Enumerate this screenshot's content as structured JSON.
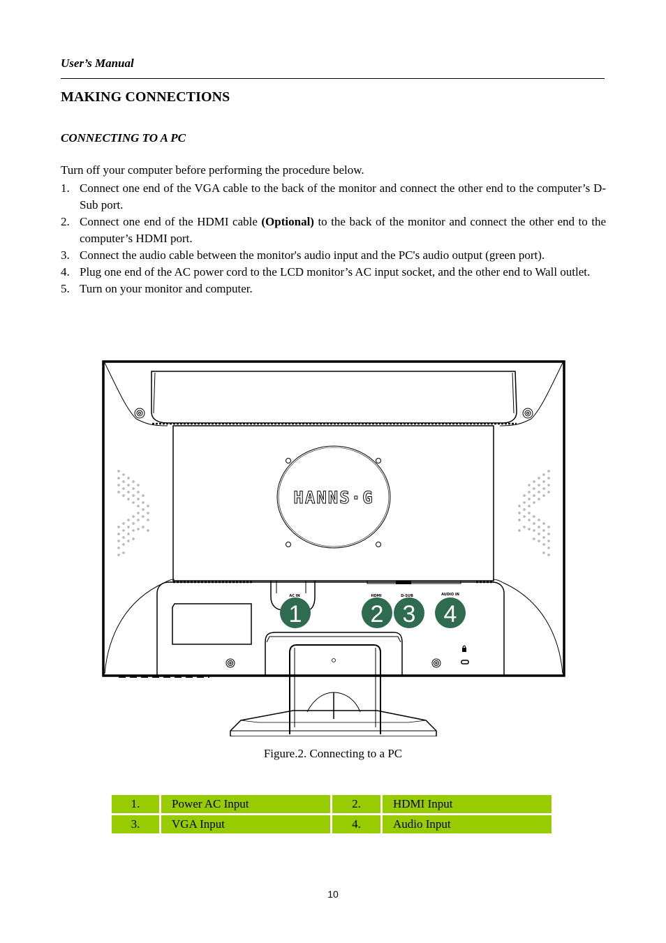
{
  "header": {
    "running_head": "User’s Manual"
  },
  "section": {
    "title": "MAKING CONNECTIONS",
    "subtitle": "CONNECTING TO A PC",
    "intro": "Turn off your computer before performing the procedure below.",
    "steps": [
      {
        "num": "1.",
        "text_before": "Connect one end of the VGA cable to the back of the monitor and connect the other end to the computer’s D-Sub port.",
        "bold": "",
        "text_after": ""
      },
      {
        "num": "2.",
        "text_before": "Connect one end of the HDMI cable ",
        "bold": "(Optional)",
        "text_after": " to the back of the monitor and connect the other end to the computer’s HDMI port."
      },
      {
        "num": "3.",
        "text_before": "Connect the audio cable between the monitor's audio input and the PC's audio output (green port).",
        "bold": "",
        "text_after": ""
      },
      {
        "num": "4.",
        "text_before": "Plug one end of the AC power cord to the LCD monitor’s AC input socket, and the other end to Wall outlet.",
        "bold": "",
        "text_after": ""
      },
      {
        "num": "5.",
        "text_before": "Turn on your monitor and computer.",
        "bold": "",
        "text_after": ""
      }
    ]
  },
  "figure": {
    "brand_logo": "HANNS·G",
    "port_labels": {
      "ac": "AC IN",
      "hdmi": "HDMI",
      "dsub": "D-SUB",
      "audio": "AUDIO IN"
    },
    "callouts": [
      "1",
      "2",
      "3",
      "4"
    ],
    "callout_color": "#2e6b4f",
    "caption": "Figure.2. Connecting to a PC"
  },
  "legend": {
    "color": "#99cc00",
    "rows": [
      [
        {
          "num": "1.",
          "label": "Power AC Input"
        },
        {
          "num": "2.",
          "label": "HDMI Input"
        }
      ],
      [
        {
          "num": "3.",
          "label": "VGA Input"
        },
        {
          "num": "4.",
          "label": "Audio Input"
        }
      ]
    ]
  },
  "footer": {
    "page_number": "10"
  }
}
